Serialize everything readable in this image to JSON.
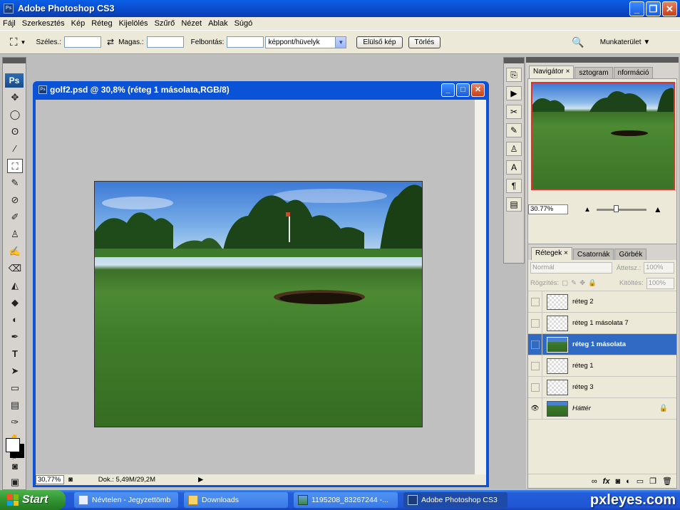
{
  "window": {
    "title": "Adobe Photoshop CS3",
    "app_icon": "Ps"
  },
  "menu": [
    "Fájl",
    "Szerkesztés",
    "Kép",
    "Réteg",
    "Kijelölés",
    "Szűrő",
    "Nézet",
    "Ablak",
    "Súgó"
  ],
  "options_bar": {
    "width_label": "Széles.:",
    "height_label": "Magas.:",
    "resolution_label": "Felbontás:",
    "resolution_unit": "képpont/hüvelyk",
    "front_image_button": "Elülső kép",
    "clear_button": "Törlés",
    "workspace_label": "Munkaterület ▼"
  },
  "tools": {
    "logo": "Ps"
  },
  "document": {
    "title": "golf2.psd @ 30,8% (réteg 1 másolata,RGB/8)",
    "zoom": "30,77%",
    "doc_size": "Dok.: 5,49M/29,2M"
  },
  "navigator": {
    "tabs": [
      "Navigátor ×",
      "sztogram",
      "nformáció"
    ],
    "zoom": "30.77%"
  },
  "layers_panel": {
    "tabs": [
      "Rétegek ×",
      "Csatornák",
      "Görbék"
    ],
    "blend_mode": "Normál",
    "opacity_label": "Áttetsz.:",
    "opacity_value": "100%",
    "lock_label": "Rögzítés:",
    "fill_label": "Kitöltés:",
    "fill_value": "100%",
    "layers": [
      {
        "name": "réteg 2",
        "visible": false,
        "selected": false
      },
      {
        "name": "réteg 1 másolata 7",
        "visible": false,
        "selected": false
      },
      {
        "name": "réteg 1 másolata",
        "visible": false,
        "selected": true
      },
      {
        "name": "réteg 1",
        "visible": false,
        "selected": false
      },
      {
        "name": "réteg 3",
        "visible": false,
        "selected": false
      },
      {
        "name": "Háttér",
        "visible": true,
        "selected": false,
        "locked": true
      }
    ]
  },
  "taskbar": {
    "start": "Start",
    "items": [
      {
        "label": "Névtelen - Jegyzettömb",
        "icon": "notepad-icon"
      },
      {
        "label": "Downloads",
        "icon": "folder-icon"
      },
      {
        "label": "1195208_83267244 -...",
        "icon": "image-viewer-icon"
      },
      {
        "label": "Adobe Photoshop CS3",
        "icon": "photoshop-icon"
      }
    ]
  },
  "watermark": "pxleyes.com"
}
